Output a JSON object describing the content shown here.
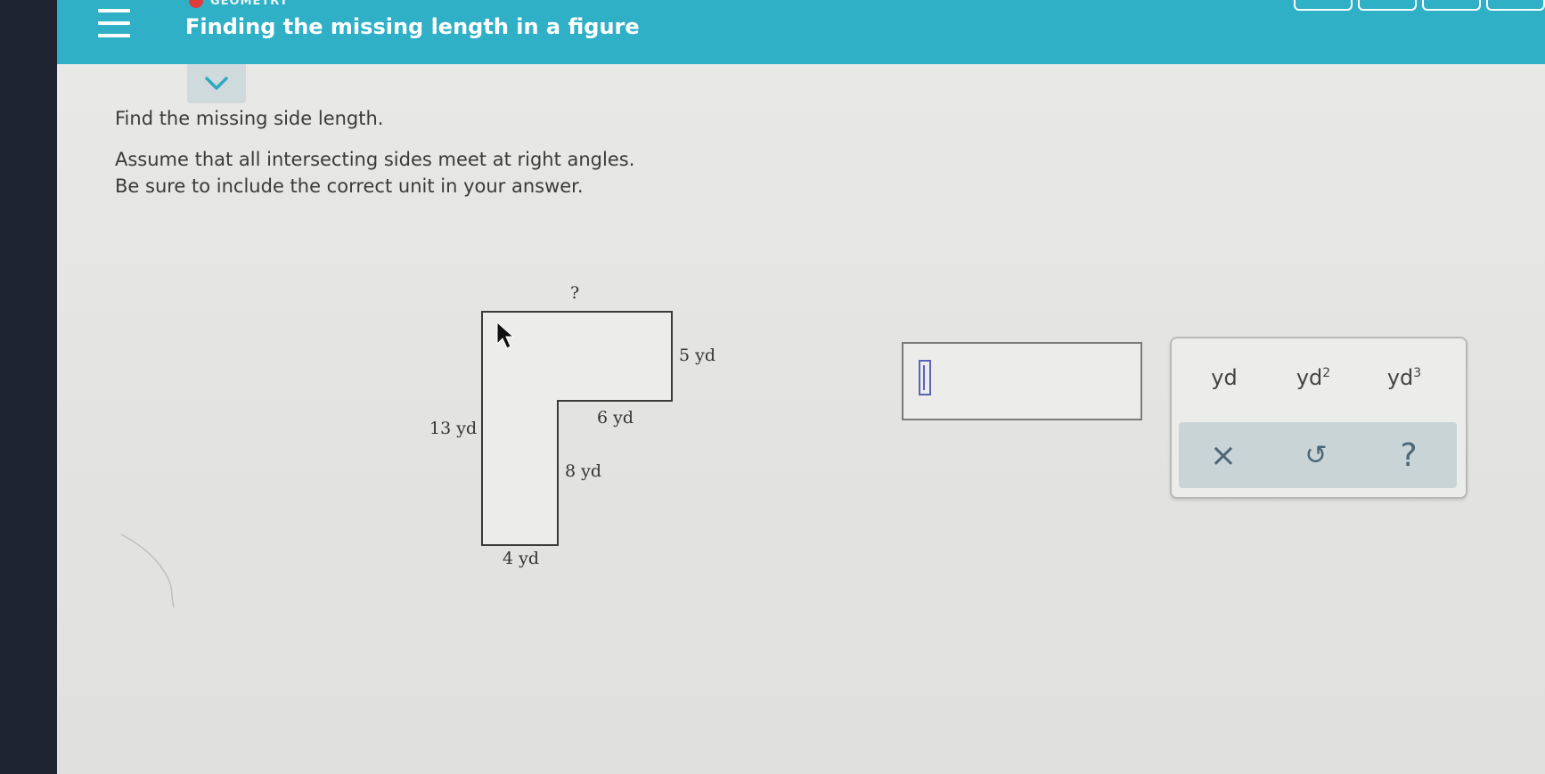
{
  "header": {
    "topic": "GEOMETRY",
    "title": "Finding the missing length in a figure"
  },
  "question": {
    "line1": "Find the missing side length.",
    "line2": "Assume that all intersecting sides meet at right angles.",
    "line3": "Be sure to include the correct unit in your answer."
  },
  "figure": {
    "labels": {
      "top": "?",
      "right_top": "5 yd",
      "left": "13 yd",
      "inner_horizontal": "6 yd",
      "inner_vertical": "8 yd",
      "bottom": "4 yd"
    }
  },
  "answer": {
    "value": ""
  },
  "keypad": {
    "units": [
      "yd",
      "yd",
      "yd"
    ],
    "unit_superscripts": [
      "",
      "2",
      "3"
    ],
    "clear_symbol": "×",
    "undo_symbol": "↺",
    "help_symbol": "?"
  },
  "colors": {
    "header": "#2fb0c6",
    "accent": "#5b63b8",
    "tool_row": "#c9d4d7"
  }
}
